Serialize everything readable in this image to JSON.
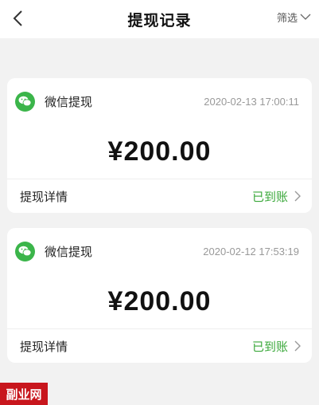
{
  "nav": {
    "title": "提现记录",
    "filter_label": "筛选"
  },
  "records": [
    {
      "method": "微信提现",
      "time": "2020-02-13 17:00:11",
      "amount": "¥200.00",
      "detail_label": "提现详情",
      "status": "已到账"
    },
    {
      "method": "微信提现",
      "time": "2020-02-12 17:53:19",
      "amount": "¥200.00",
      "detail_label": "提现详情",
      "status": "已到账"
    }
  ],
  "colors": {
    "accent_green": "#3aa83a",
    "wechat_green": "#3bb54a",
    "watermark_red": "#c8161d"
  },
  "watermark": "副业网"
}
